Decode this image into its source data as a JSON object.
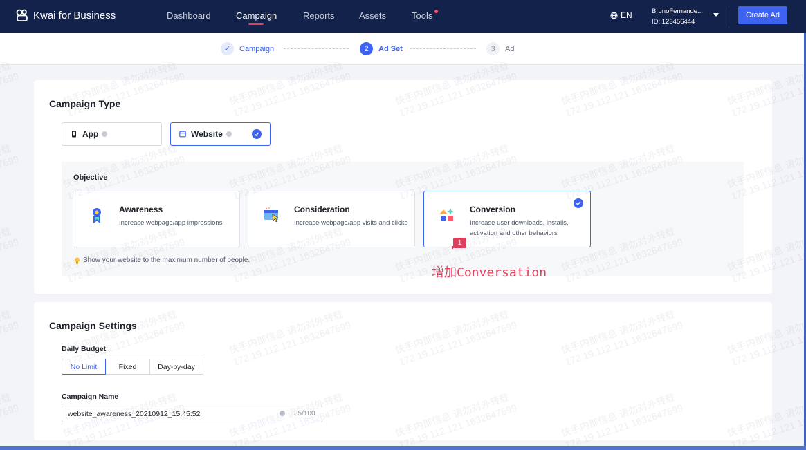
{
  "nav": {
    "brand": "Kwai for Business",
    "items": [
      "Dashboard",
      "Campaign",
      "Reports",
      "Assets",
      "Tools"
    ],
    "active": "Campaign",
    "lang": "EN",
    "user_name": "BrunoFernande...",
    "user_id": "ID: 123456444",
    "create_label": "Create Ad"
  },
  "steps": [
    {
      "num": "✓",
      "label": "Campaign"
    },
    {
      "num": "2",
      "label": "Ad Set"
    },
    {
      "num": "3",
      "label": "Ad"
    }
  ],
  "campaign_type": {
    "title": "Campaign Type",
    "options": [
      "App",
      "Website"
    ],
    "selected": "Website"
  },
  "objective": {
    "label": "Objective",
    "cards": [
      {
        "title": "Awareness",
        "desc": "Increase webpage/app impressions"
      },
      {
        "title": "Consideration",
        "desc": "Increase webpage/app visits and clicks"
      },
      {
        "title": "Conversion",
        "desc": "Increase user downloads, installs, activation and other behaviors"
      }
    ],
    "selected": "Conversion",
    "tip": "Show your website to the maximum number of people."
  },
  "annotation": {
    "badge": "1",
    "text": "增加Conversation"
  },
  "settings": {
    "title": "Campaign Settings",
    "budget_label": "Daily Budget",
    "budget_options": [
      "No Limit",
      "Fixed",
      "Day-by-day"
    ],
    "budget_selected": "No Limit",
    "name_label": "Campaign Name",
    "name_value": "website_awareness_20210912_15:45:52",
    "name_counter": "35/100"
  },
  "watermark": {
    "line1": "快手内部信息 请勿对外转载",
    "line2": "172.19.112.121 1632647699"
  },
  "colors": {
    "nav_bg": "#13224b",
    "accent": "#3e63f2",
    "annotation": "#e23e5c"
  }
}
